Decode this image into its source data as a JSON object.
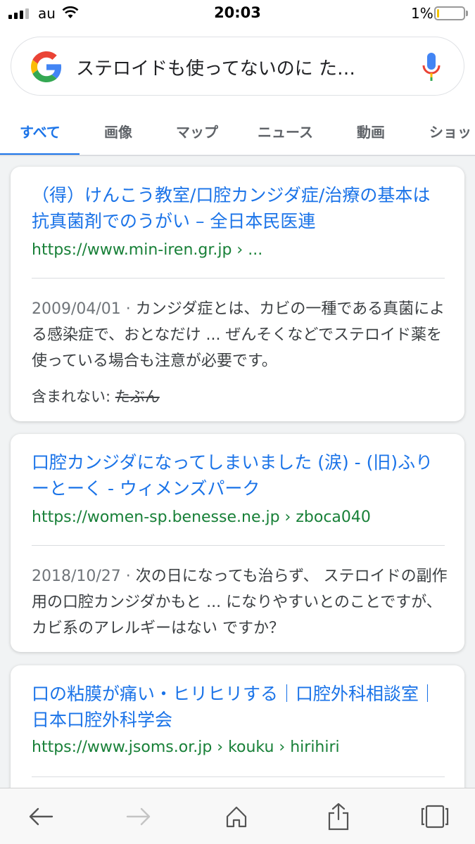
{
  "status_bar": {
    "carrier": "au",
    "time": "20:03",
    "battery_percent": "1%",
    "battery_level": 0.05
  },
  "search": {
    "query": "ステロイドも使ってないのに た…",
    "logo_icon": "google-g-icon",
    "mic_icon": "microphone-icon"
  },
  "tabs": [
    {
      "label": "すべて",
      "active": true
    },
    {
      "label": "画像"
    },
    {
      "label": "マップ"
    },
    {
      "label": "ニュース"
    },
    {
      "label": "動画"
    },
    {
      "label": "ショッ"
    }
  ],
  "results": [
    {
      "title": "（得）けんこう教室/口腔カンジダ症/治療の基本は抗真菌剤でのうがい – 全日本民医連",
      "url": "https://www.min-iren.gr.jp › ...",
      "date": "2009/04/01",
      "separator": " · ",
      "snippet": "カンジダ症とは、カビの一種である真菌による感染症で、おとなだけ ... ぜんそくなどでステロイド薬を使っている場合も注意が必要です。",
      "missing_label": "含まれない: ",
      "missing_term": "たぶん"
    },
    {
      "title": "口腔カンジダになってしまいました (涙) - (旧)ふりーとーく - ウィメンズパーク",
      "url": "https://women-sp.benesse.ne.jp › zboca040",
      "date": "2018/10/27",
      "separator": " · ",
      "snippet": "次の日になっても治らず、 ステロイドの副作用の口腔カンジダかもと ... になりやすいとのことですが、カビ系のアレルギーはない ですか？"
    },
    {
      "title": "口の粘膜が痛い・ヒリヒリする｜口腔外科相談室｜日本口腔外科学会",
      "url": "https://www.jsoms.or.jp › kouku › hirihiri"
    }
  ],
  "toolbar": {
    "back_icon": "back-arrow-icon",
    "forward_icon": "forward-arrow-icon",
    "home_icon": "home-icon",
    "share_icon": "share-icon",
    "tabs_icon": "tabs-icon"
  },
  "colors": {
    "link": "#1a73e8",
    "url": "#188038",
    "snippet": "#3c4043",
    "date": "#70757a",
    "background": "#f1f3f4"
  }
}
